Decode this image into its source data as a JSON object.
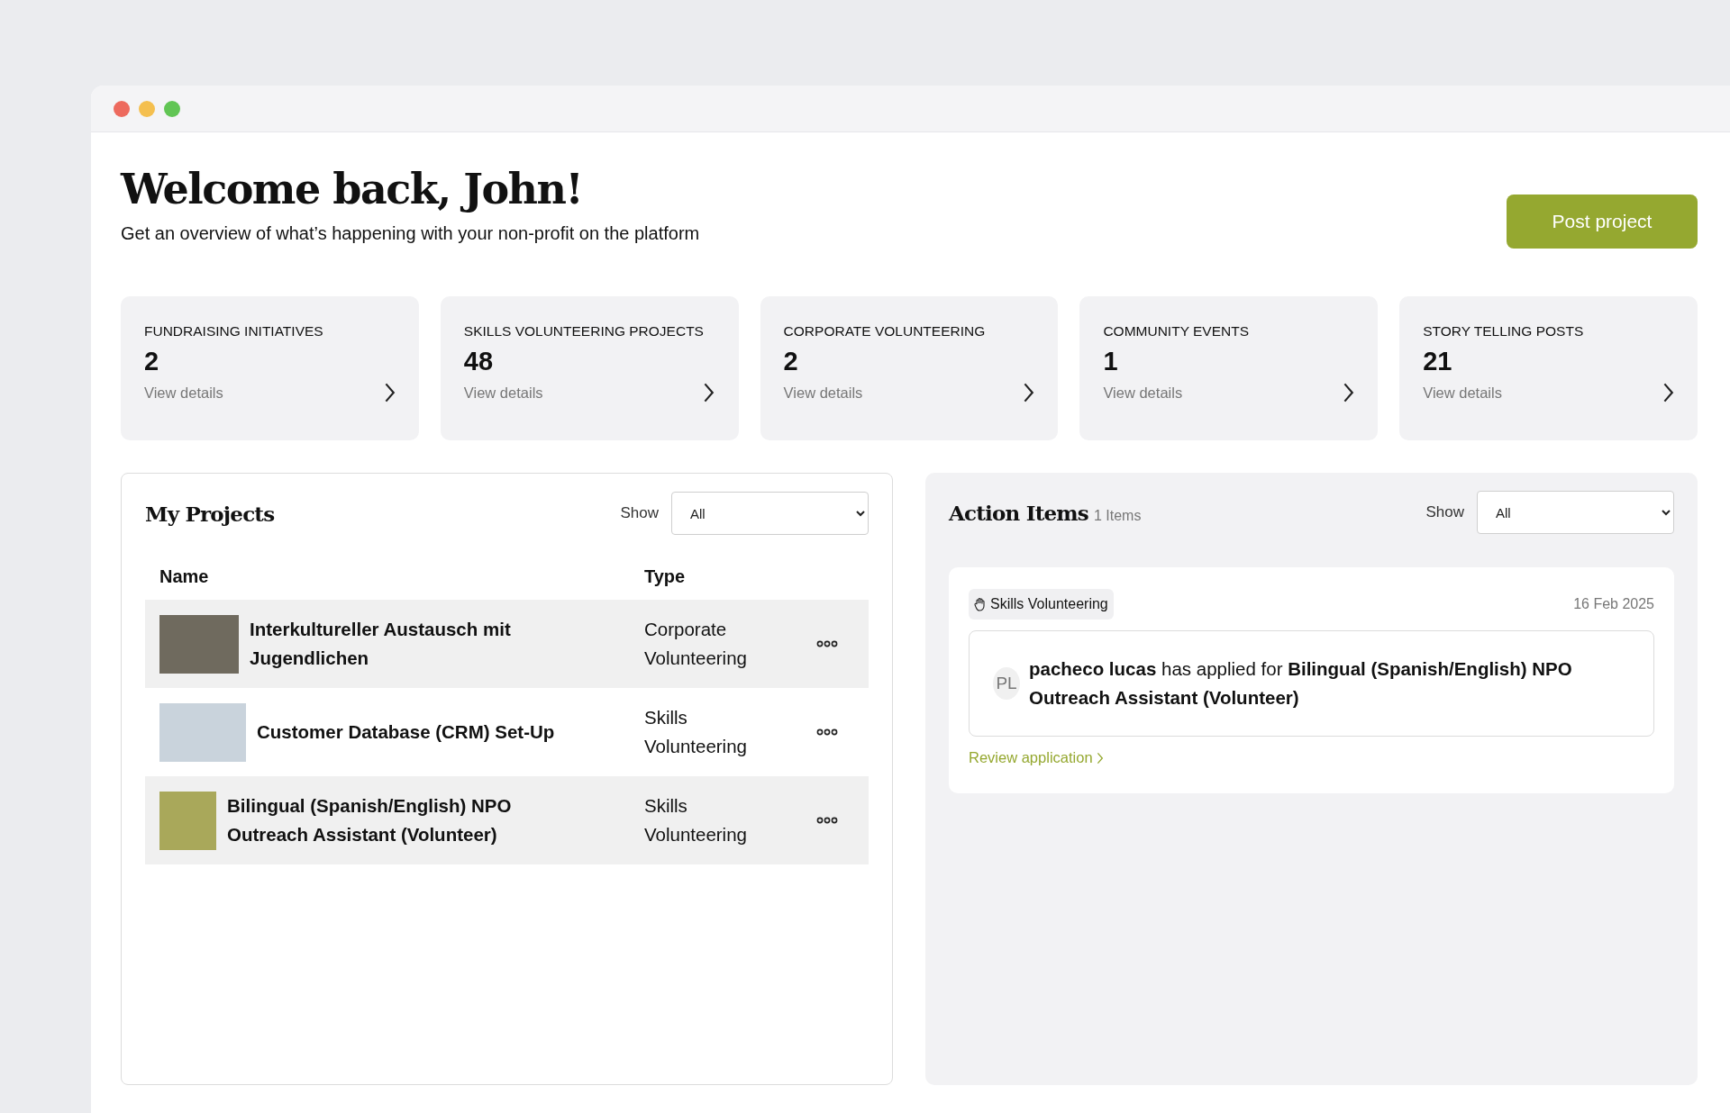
{
  "header": {
    "title": "Welcome back, John!",
    "subtitle": "Get an overview of what’s happening with your non-profit on the platform",
    "button": "Post project"
  },
  "stats": [
    {
      "label": "FUNDRAISING INITIATIVES",
      "value": "2",
      "link": "View details"
    },
    {
      "label": "SKILLS VOLUNTEERING PROJECTS",
      "value": "48",
      "link": "View details"
    },
    {
      "label": "CORPORATE VOLUNTEERING",
      "value": "2",
      "link": "View details"
    },
    {
      "label": "COMMUNITY EVENTS",
      "value": "1",
      "link": "View details"
    },
    {
      "label": "STORY TELLING POSTS",
      "value": "21",
      "link": "View details"
    }
  ],
  "projects": {
    "title": "My Projects",
    "filter_label": "Show",
    "filter_value": "All",
    "columns": [
      "Name",
      "Type"
    ],
    "rows": [
      {
        "name": "Interkultureller Austausch mit Jugendlichen",
        "type": "Corporate Volunteering"
      },
      {
        "name": "Customer Database (CRM) Set-Up",
        "type": "Skills Volunteering"
      },
      {
        "name": "Bilingual (Spanish/English) NPO Outreach Assistant (Volunteer)",
        "type": "Skills Volunteering"
      }
    ]
  },
  "action_items": {
    "title": "Action Items",
    "count": "1 Items",
    "filter_label": "Show",
    "filter_value": "All",
    "items": [
      {
        "tag": "Skills Volunteering",
        "date": "16 Feb 2025",
        "initials": "PL",
        "message": "**pacheco lucas** has applied for **Bilingual (Spanish/English) NPO Outreach Assistant (Volunteer)**",
        "link": "Review application"
      }
    ]
  }
}
